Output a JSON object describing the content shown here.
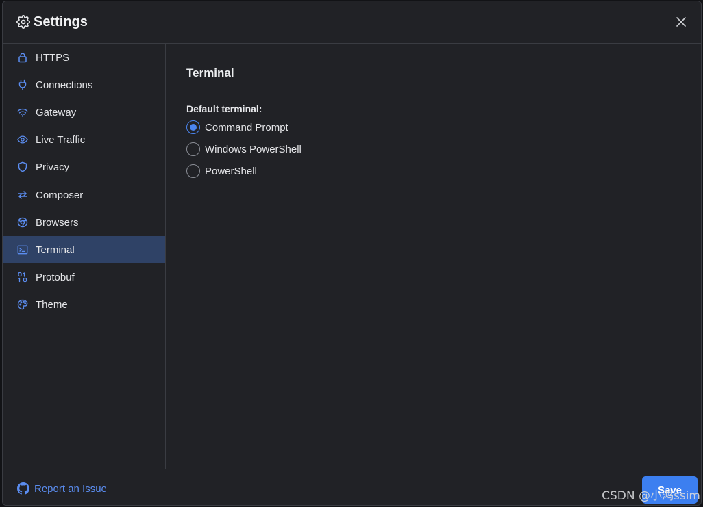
{
  "window": {
    "title": "Settings"
  },
  "sidebar": {
    "items": [
      {
        "label": "HTTPS",
        "icon": "lock-icon"
      },
      {
        "label": "Connections",
        "icon": "plug-icon"
      },
      {
        "label": "Gateway",
        "icon": "wifi-icon"
      },
      {
        "label": "Live Traffic",
        "icon": "eye-icon"
      },
      {
        "label": "Privacy",
        "icon": "shield-icon"
      },
      {
        "label": "Composer",
        "icon": "swap-arrows-icon"
      },
      {
        "label": "Browsers",
        "icon": "chrome-icon"
      },
      {
        "label": "Terminal",
        "icon": "terminal-icon",
        "active": true
      },
      {
        "label": "Protobuf",
        "icon": "binary-icon"
      },
      {
        "label": "Theme",
        "icon": "palette-icon"
      }
    ]
  },
  "main": {
    "section_title": "Terminal",
    "default_terminal": {
      "label": "Default terminal:",
      "options": [
        {
          "label": "Command Prompt",
          "selected": true
        },
        {
          "label": "Windows PowerShell",
          "selected": false
        },
        {
          "label": "PowerShell",
          "selected": false
        }
      ]
    }
  },
  "footer": {
    "report_label": "Report an Issue",
    "save_label": "Save"
  },
  "watermark": "CSDN @小鸿ssim",
  "colors": {
    "accent": "#3c7ff0",
    "icon_blue": "#5b8df0",
    "active_bg": "#2f4266",
    "panel_bg": "#212226"
  }
}
